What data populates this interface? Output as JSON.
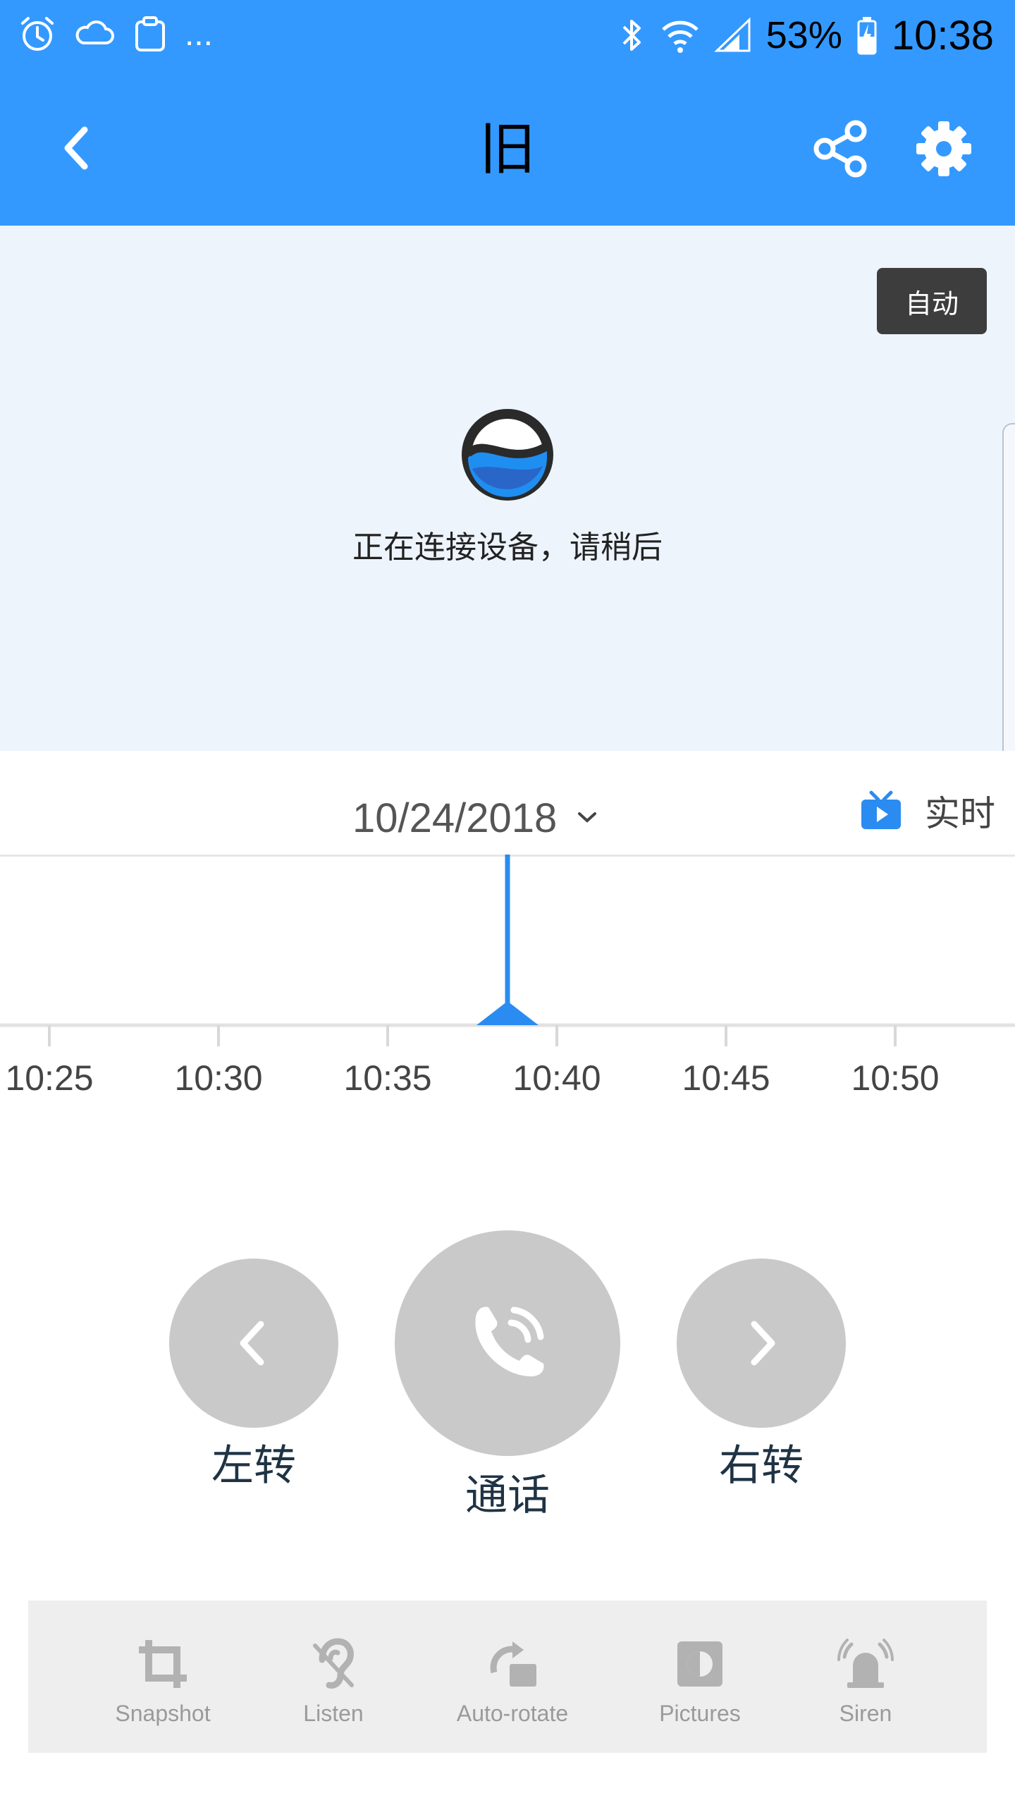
{
  "status_bar": {
    "left_icons": [
      "alarm-icon",
      "cloud-icon",
      "clipboard-icon"
    ],
    "more": "...",
    "battery_percent": "53%",
    "time": "10:38"
  },
  "header": {
    "title": "旧",
    "back_icon": "chevron-left-icon",
    "share_icon": "share-icon",
    "settings_icon": "gear-icon"
  },
  "video": {
    "mode_badge": "自动",
    "connecting_text": "正在连接设备，请稍后"
  },
  "date_bar": {
    "date": "10/24/2018",
    "live_label": "实时"
  },
  "timeline": {
    "ticks": [
      "10:25",
      "10:30",
      "10:35",
      "10:40",
      "10:45",
      "10:50"
    ],
    "cursor_time": "10:38",
    "accent_color": "#3399ff"
  },
  "controls": {
    "left_label": "左转",
    "call_label": "通话",
    "right_label": "右转"
  },
  "toolbar": {
    "items": [
      {
        "label": "Snapshot",
        "icon": "crop-icon"
      },
      {
        "label": "Listen",
        "icon": "ear-icon"
      },
      {
        "label": "Auto-rotate",
        "icon": "rotate-icon"
      },
      {
        "label": "Pictures",
        "icon": "pictures-icon"
      },
      {
        "label": "Siren",
        "icon": "siren-icon"
      }
    ]
  },
  "colors": {
    "primary": "#3399ff",
    "video_bg": "#edf4fb",
    "button_grey": "#c9c9c9"
  }
}
